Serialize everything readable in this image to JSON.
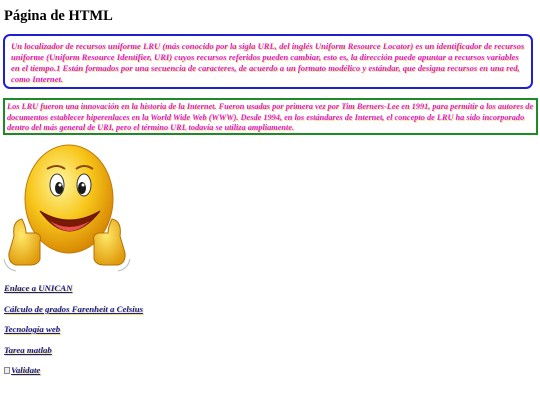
{
  "page": {
    "title": "Página de HTML"
  },
  "paragraphs": {
    "p1": "Un localizador de recursos uniforme LRU (más conocido por la sigla URL, del inglés Uniform Resource Locator) es un identificador de recursos uniforme (Uniform Resource Identifier, URI) cuyos recursos referidos pueden cambiar, esto es, la dirección puede apuntar a recursos variables en el tiempo.1 Están formados por una secuencia de caracteres, de acuerdo a un formato modélico y estándar, que designa recursos en una red, como Internet.",
    "p2": "Los LRU fueron una innovación en la historia de la Internet. Fueron usadas por primera vez por Tim Berners-Lee en 1991, para permitir a los autores de documentos establecer hiperenlaces en la World Wide Web (WWW). Desde 1994, en los estándares de Internet, el concepto de LRU ha sido incorporado dentro del más general de URI, pero el término URL todavía se utiliza ampliamente."
  },
  "links": [
    {
      "label": "Enlace a UNICAN"
    },
    {
      "label": "Cálculo de grados Farenheit a Celsius"
    },
    {
      "label": "Tecnología web"
    },
    {
      "label": "Tarea matlab"
    }
  ],
  "validate": {
    "label": "Validate"
  },
  "icons": {
    "emoji": "smiley-thumbs-up-icon"
  },
  "colors": {
    "text_magenta": "#e020d8",
    "box1_border": "#1f1fd0",
    "box2_border": "#1e8a28",
    "link": "#1a1aa0"
  }
}
